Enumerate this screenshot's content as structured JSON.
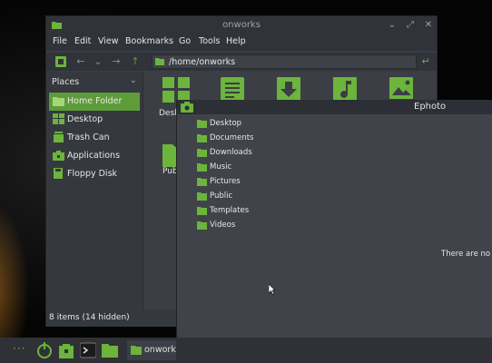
{
  "colors": {
    "accent": "#5e9c3a",
    "icon_green": "#6cb43c",
    "window_bg": "#3b3e45",
    "panel_bg": "#2f3136"
  },
  "nemo": {
    "title": "onworks",
    "menu": [
      "File",
      "Edit",
      "View",
      "Bookmarks",
      "Go",
      "Tools",
      "Help"
    ],
    "path": "/home/onworks",
    "sidebar": {
      "heading": "Places",
      "items": [
        {
          "label": "Home Folder",
          "icon": "home-folder-icon",
          "active": true
        },
        {
          "label": "Desktop",
          "icon": "desktop-icon",
          "active": false
        },
        {
          "label": "Trash Can",
          "icon": "trash-icon",
          "active": false
        },
        {
          "label": "Applications",
          "icon": "applications-icon",
          "active": false
        },
        {
          "label": "Floppy Disk",
          "icon": "floppy-icon",
          "active": false
        }
      ]
    },
    "content": {
      "visible_labels": [
        "Desk",
        "Pub"
      ],
      "icons": [
        "desktop-folder-icon",
        "documents-folder-icon",
        "downloads-folder-icon",
        "music-folder-icon",
        "pictures-folder-icon",
        "public-folder-icon"
      ]
    },
    "status": "8 items (14 hidden)"
  },
  "ephoto": {
    "title": "Ephoto",
    "folders": [
      "Desktop",
      "Documents",
      "Downloads",
      "Music",
      "Pictures",
      "Public",
      "Templates",
      "Videos"
    ],
    "empty_message": "There are no i"
  },
  "panel": {
    "menu_dots": "···",
    "task_label": "onwork"
  }
}
